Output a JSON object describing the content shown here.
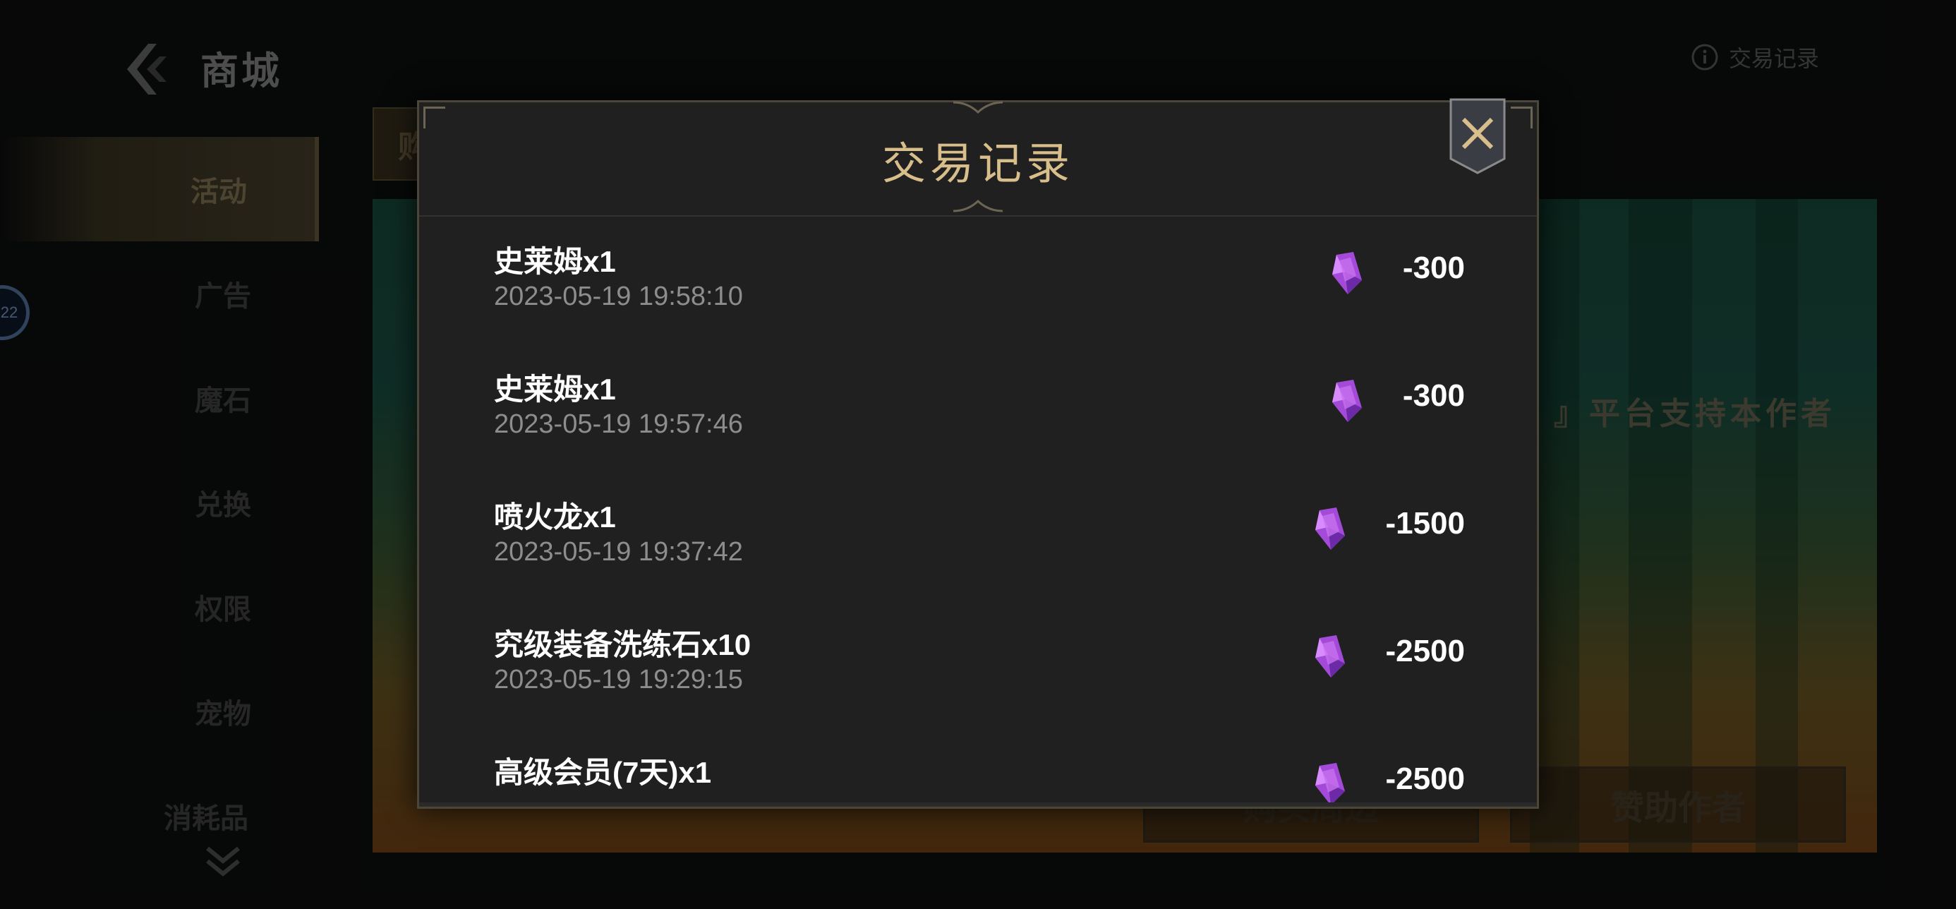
{
  "header": {
    "title": "商城",
    "record_link": "交易记录"
  },
  "sidebar": {
    "items": [
      {
        "label": "活动",
        "active": true
      },
      {
        "label": "广告",
        "active": false
      },
      {
        "label": "魔石",
        "active": false
      },
      {
        "label": "兑换",
        "active": false
      },
      {
        "label": "权限",
        "active": false
      },
      {
        "label": "宠物",
        "active": false
      },
      {
        "label": "消耗品",
        "active": false
      }
    ],
    "side_badge": "22"
  },
  "tab_chip": "购",
  "banner": {
    "slogan": "』平台支持本作者",
    "buttons": [
      "购买周边",
      "赞助作者"
    ]
  },
  "modal": {
    "title": "交易记录",
    "close_icon": "close-x-icon",
    "currency_icon": "purple-crystal-icon",
    "records": [
      {
        "name": "史莱姆x1",
        "time": "2023-05-19 19:58:10",
        "amount": "-300"
      },
      {
        "name": "史莱姆x1",
        "time": "2023-05-19 19:57:46",
        "amount": "-300"
      },
      {
        "name": "喷火龙x1",
        "time": "2023-05-19 19:37:42",
        "amount": "-1500"
      },
      {
        "name": "究级装备洗练石x10",
        "time": "2023-05-19 19:29:15",
        "amount": "-2500"
      },
      {
        "name": "高级会员(7天)x1",
        "time": "",
        "amount": "-2500"
      }
    ]
  },
  "colors": {
    "gold_title": "#d8be8a",
    "modal_bg": "#202020",
    "crystal": "#b04be0"
  }
}
